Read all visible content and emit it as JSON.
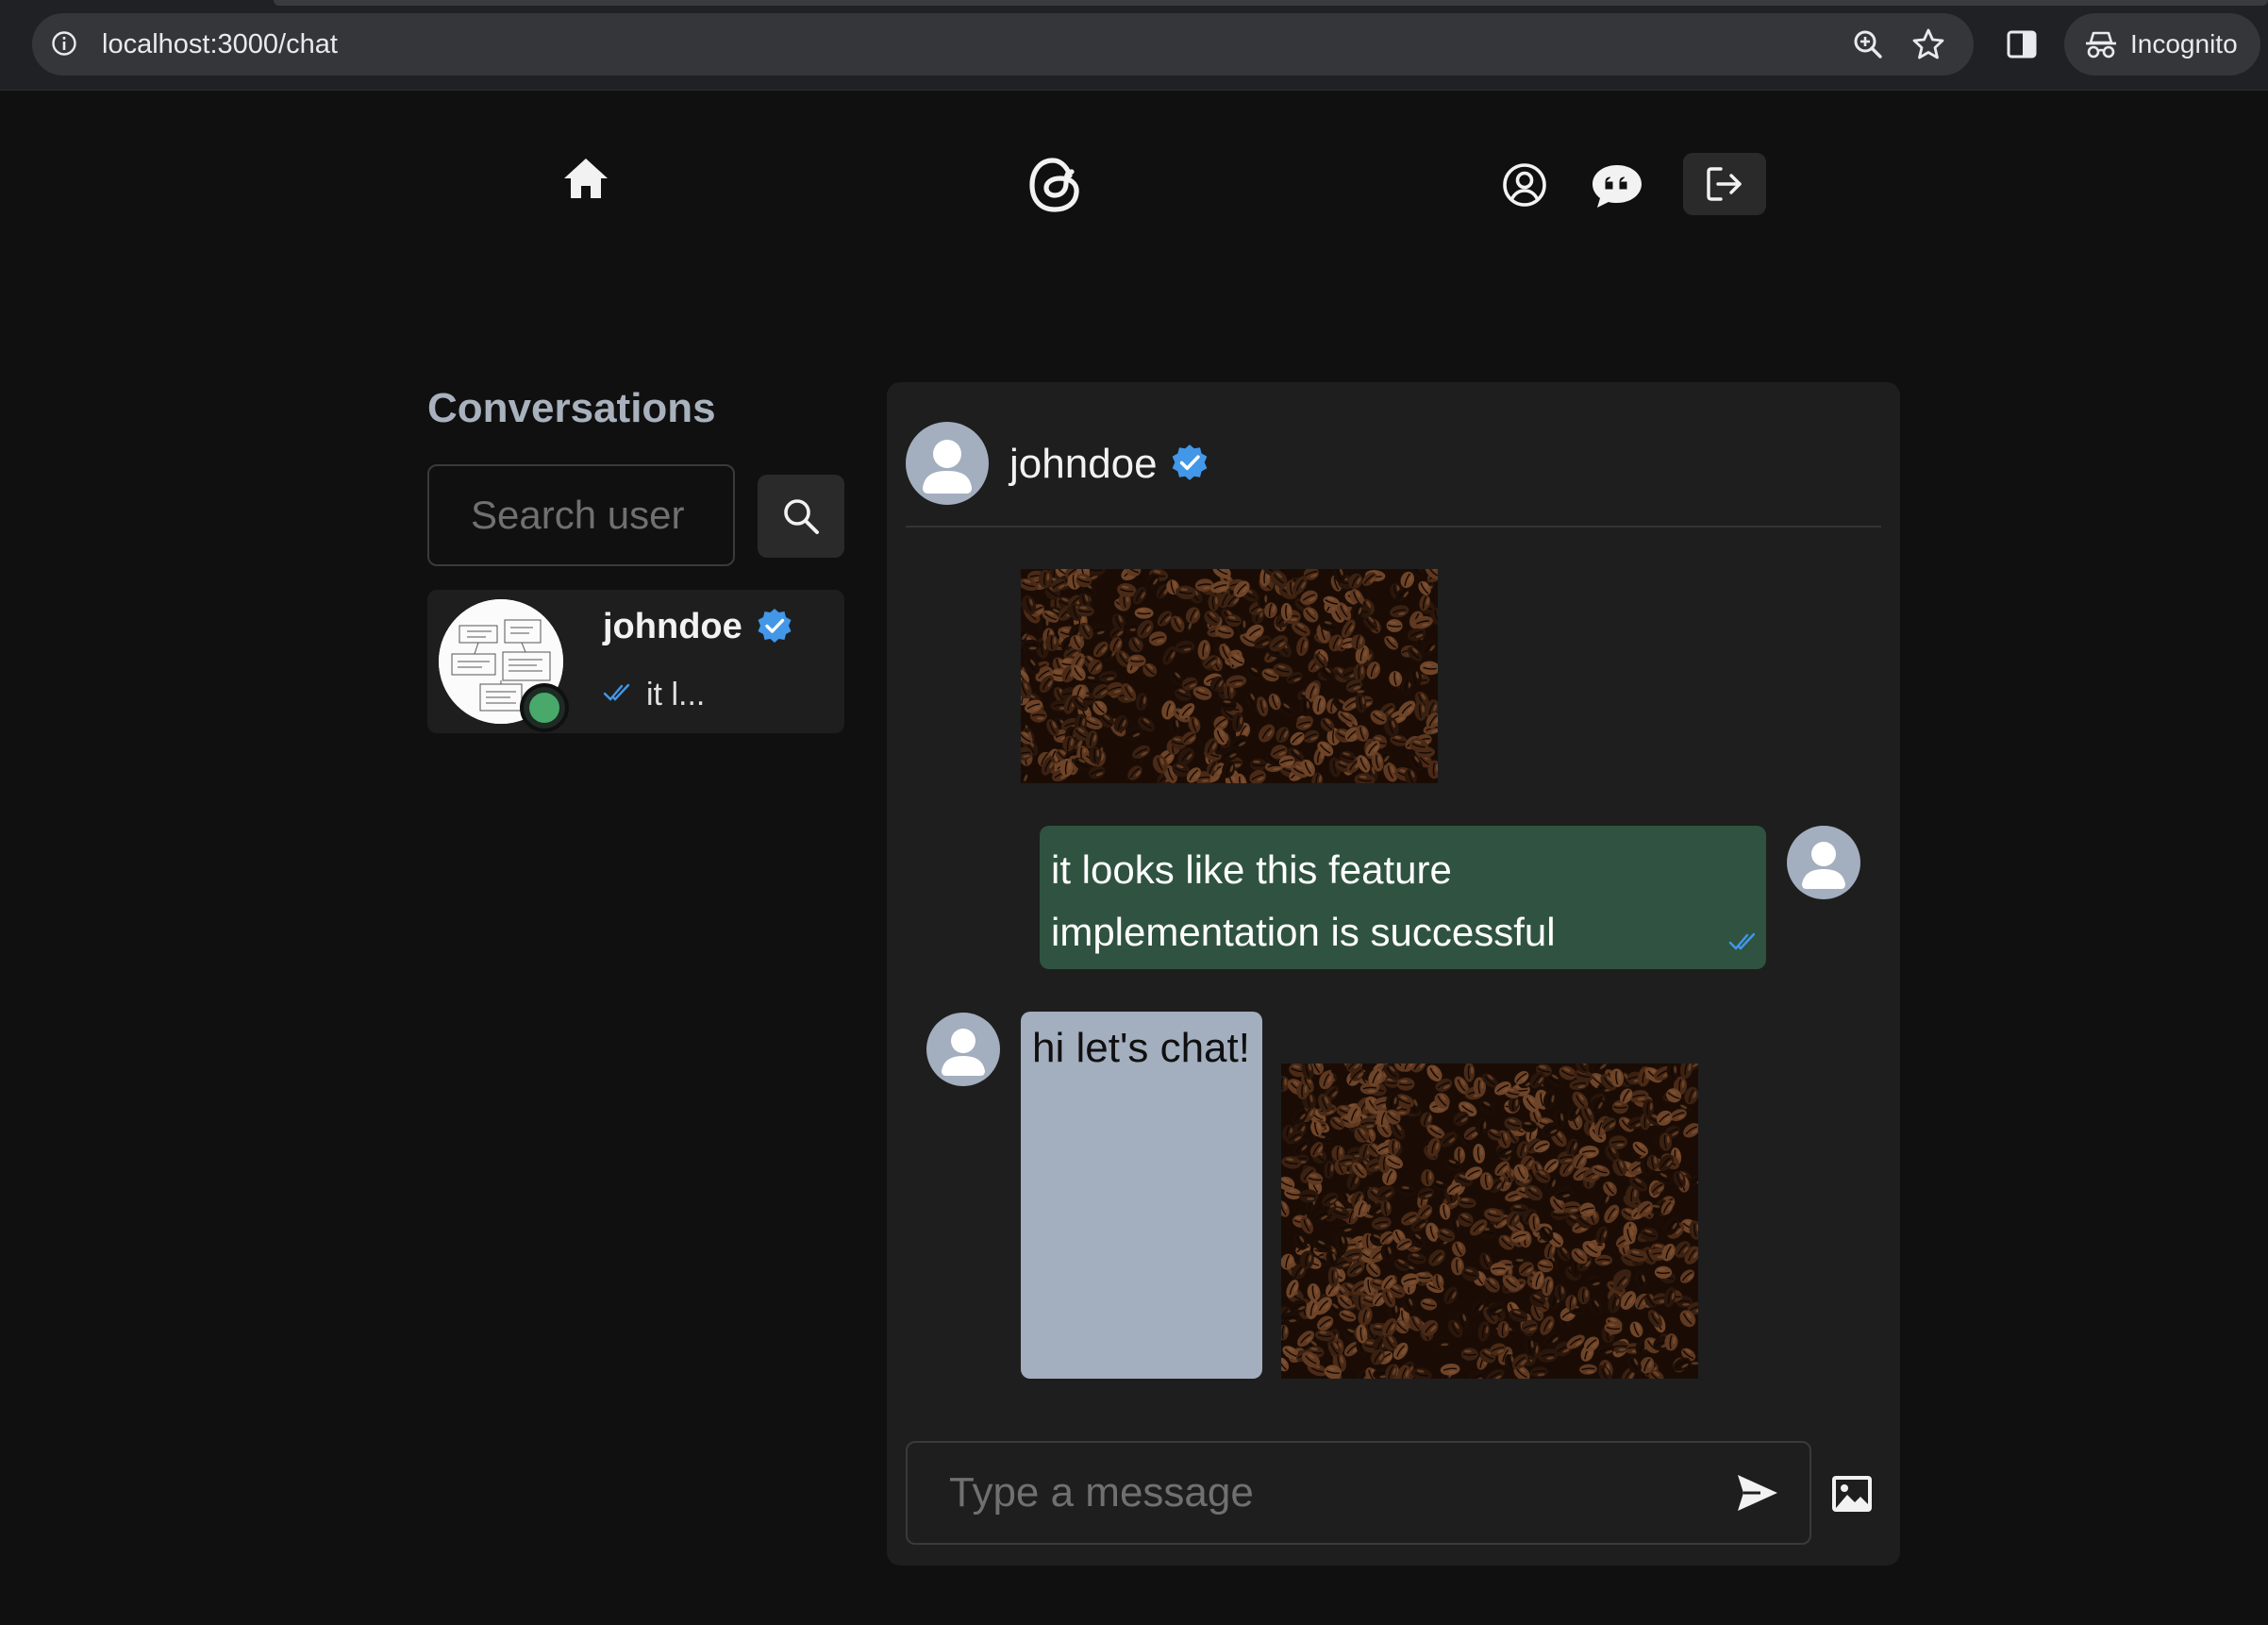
{
  "browser": {
    "url": "localhost:3000/chat",
    "incognito_label": "Incognito"
  },
  "nav": {
    "home_icon": "home-icon",
    "logo_icon": "threads-logo-icon",
    "profile_icon": "user-circle-icon",
    "chat_icon": "chat-bubble-icon",
    "logout_icon": "logout-icon"
  },
  "sidebar": {
    "title": "Conversations",
    "search_placeholder": "Search user",
    "conversations": [
      {
        "username": "johndoe",
        "verified": true,
        "online": true,
        "last_message_preview": "it l..."
      }
    ]
  },
  "chat": {
    "header": {
      "username": "johndoe",
      "verified": true
    },
    "messages": [
      {
        "sender": "self",
        "type": "image",
        "image": "coffee beans"
      },
      {
        "sender": "self",
        "type": "text",
        "text": "it looks like this feature implementation is successful",
        "seen": true
      },
      {
        "sender": "other",
        "type": "text",
        "text": "hi let's chat!"
      },
      {
        "sender": "other",
        "type": "image",
        "image": "coffee beans"
      }
    ],
    "composer": {
      "placeholder": "Type a message"
    }
  },
  "colors": {
    "background": "#101010",
    "panel": "#1e1e1e",
    "own_bubble": "#2f5340",
    "peer_bubble": "#a3aebf",
    "verified_blue": "#4297e8",
    "online_green": "#48a96a"
  }
}
